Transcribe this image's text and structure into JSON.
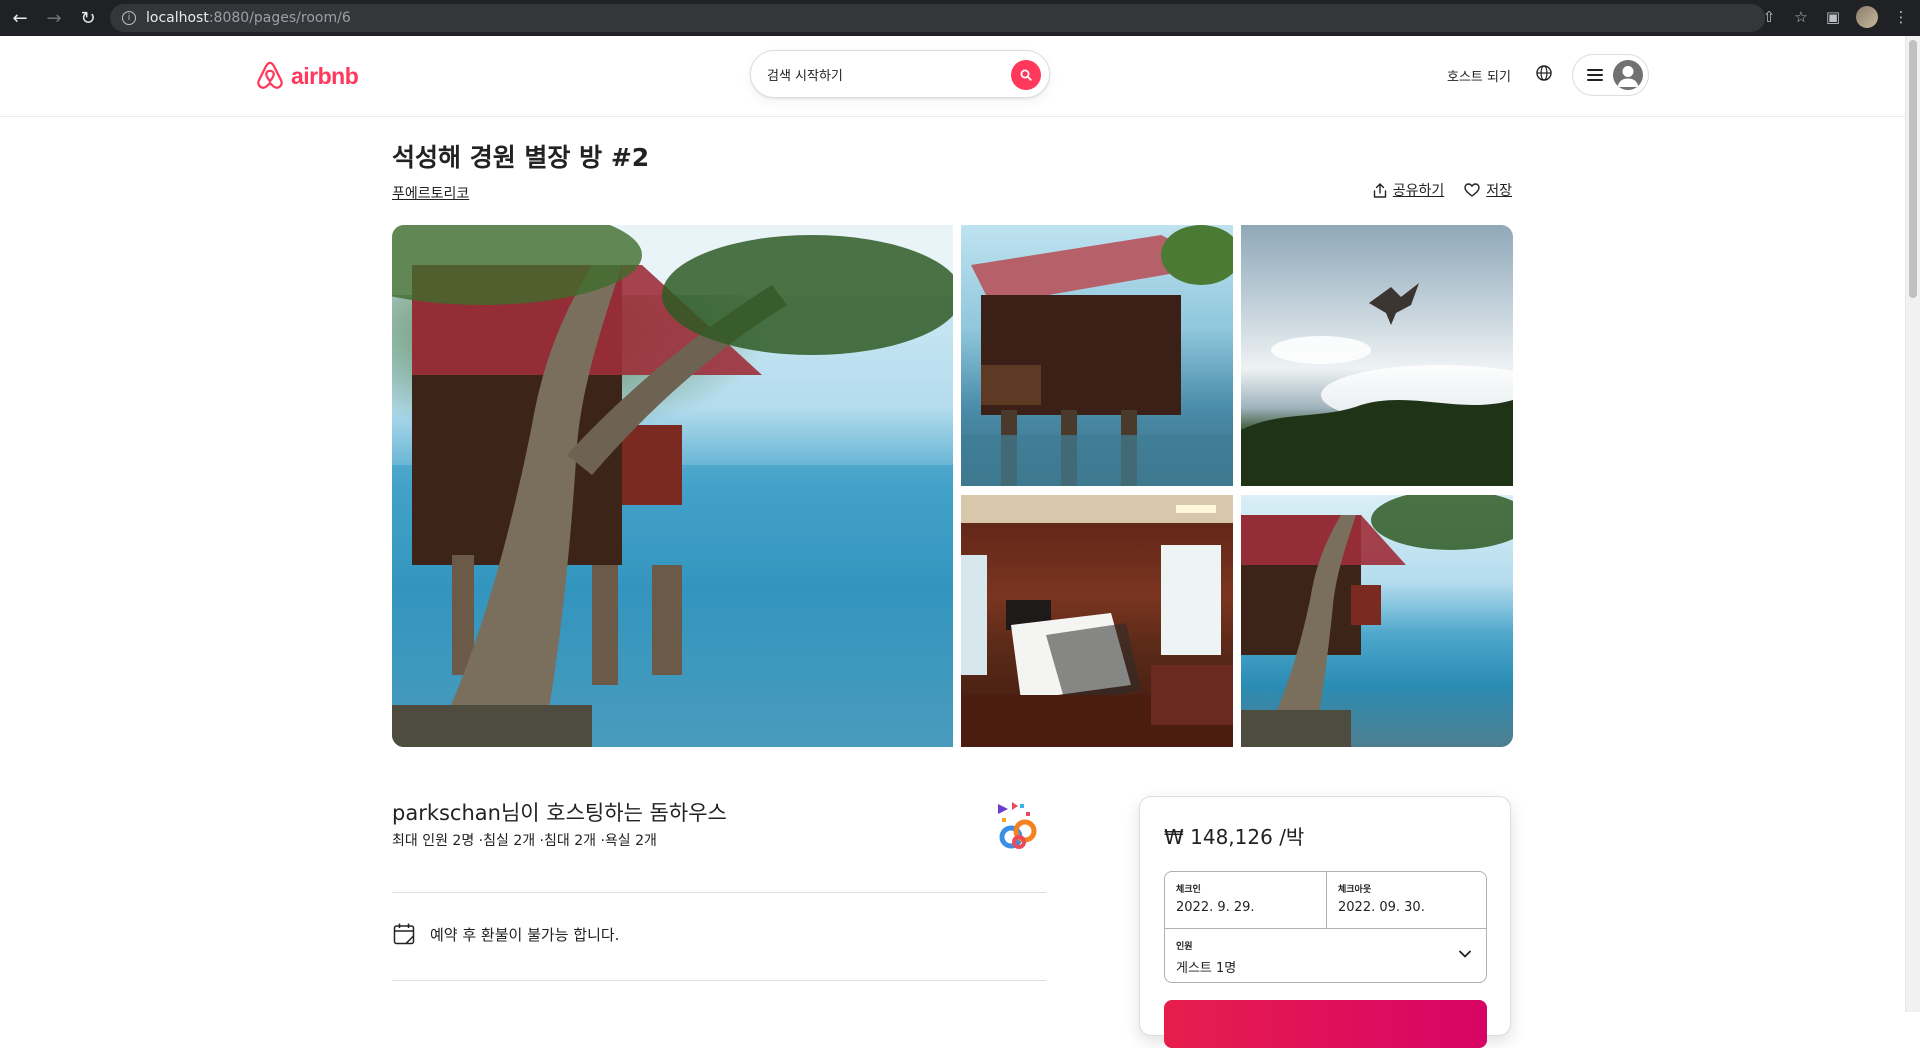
{
  "browser": {
    "url_host": "localhost",
    "url_path": ":8080/pages/room/6"
  },
  "header": {
    "logo_text": "airbnb",
    "search_placeholder": "검색 시작하기",
    "host_link": "호스트 되기"
  },
  "listing": {
    "title": "석성해 경원 별장 방 #2",
    "location": "푸에르토리코",
    "share_label": "공유하기",
    "save_label": "저장",
    "photos": [
      "main-house-over-sea",
      "house-on-stilts",
      "bird-in-sky",
      "bedroom",
      "house-and-tree"
    ]
  },
  "host_section": {
    "title": "parkschan님이 호스팅하는 돔하우스",
    "details": "최대 인원 2명 ·침실 2개 ·침대 2개 ·욕실 2개",
    "refund_notice": "예약 후 환불이 불가능 합니다."
  },
  "booking": {
    "price": "₩ 148,126 /박",
    "checkin_label": "체크인",
    "checkin_value": "2022. 9. 29.",
    "checkout_label": "체크아웃",
    "checkout_value": "2022. 09. 30.",
    "guests_label": "인원",
    "guests_value": "게스트 1명"
  },
  "colors": {
    "brand": "#ff385c",
    "reserve_gradient_start": "#e61e4d",
    "reserve_gradient_end": "#d70466"
  }
}
